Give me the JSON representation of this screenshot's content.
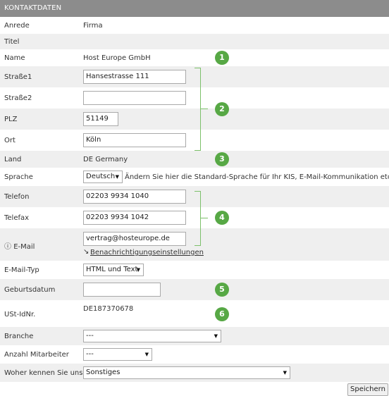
{
  "header": {
    "title": "KONTAKTDATEN"
  },
  "fields": {
    "anrede": {
      "label": "Anrede",
      "value": "Firma"
    },
    "titel": {
      "label": "Titel"
    },
    "name": {
      "label": "Name",
      "value": "Host Europe GmbH"
    },
    "strasse1": {
      "label": "Straße1",
      "value": "Hansestrasse 111"
    },
    "strasse2": {
      "label": "Straße2",
      "value": ""
    },
    "plz": {
      "label": "PLZ",
      "value": "51149"
    },
    "ort": {
      "label": "Ort",
      "value": "Köln"
    },
    "land": {
      "label": "Land",
      "value": "DE Germany"
    },
    "sprache": {
      "label": "Sprache",
      "value": "Deutsch",
      "hint": "Ändern Sie hier die Standard-Sprache für Ihr KIS, E-Mail-Kommunikation etc."
    },
    "telefon": {
      "label": "Telefon",
      "value": "02203 9934 1040"
    },
    "telefax": {
      "label": "Telefax",
      "value": "02203 9934 1042"
    },
    "email": {
      "label": "E-Mail",
      "value": "vertrag@hosteurope.de",
      "link": "Benachrichtigungseinstellungen"
    },
    "emailtyp": {
      "label": "E-Mail-Typ",
      "value": "HTML und Text"
    },
    "geburtsdatum": {
      "label": "Geburtsdatum",
      "value": ""
    },
    "ustid": {
      "label": "USt-IdNr.",
      "value": "DE187370678"
    },
    "branche": {
      "label": "Branche",
      "value": "---"
    },
    "mitarbeiter": {
      "label": "Anzahl Mitarbeiter",
      "value": "---"
    },
    "woher": {
      "label": "Woher kennen Sie uns?",
      "value": "Sonstiges"
    }
  },
  "badges": [
    "1",
    "2",
    "3",
    "4",
    "5",
    "6"
  ],
  "actions": {
    "save_label": "Speichern"
  },
  "colors": {
    "header_bg": "#8c8c8c",
    "badge": "#57a845",
    "row_alt": "#efefef"
  }
}
